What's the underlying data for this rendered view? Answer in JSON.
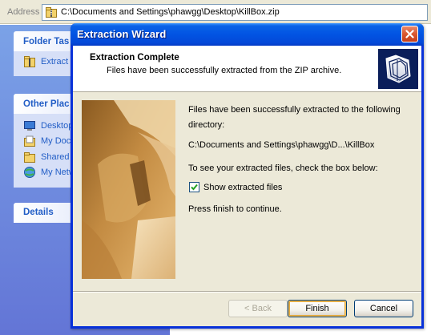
{
  "address_bar": {
    "label": "Address",
    "path": "C:\\Documents and Settings\\phawgg\\Desktop\\KillBox.zip"
  },
  "task_pane": {
    "folder_tasks": {
      "title": "Folder Tas",
      "items": [
        {
          "label": "Extract",
          "icon": "extract-zip-icon"
        }
      ]
    },
    "other_places": {
      "title": "Other Plac",
      "items": [
        {
          "label": "Desktop",
          "icon": "desktop-icon"
        },
        {
          "label": "My Doc",
          "icon": "my-documents-icon"
        },
        {
          "label": "Shared",
          "icon": "shared-folder-icon"
        },
        {
          "label": "My Netw",
          "icon": "my-network-icon"
        }
      ]
    },
    "details": {
      "title": "Details"
    }
  },
  "wizard": {
    "title": "Extraction Wizard",
    "header_title": "Extraction Complete",
    "header_subtitle": "Files have been successfully extracted from the ZIP archive.",
    "message_line1": "Files have been successfully extracted to the following",
    "message_line2": "directory:",
    "directory": "C:\\Documents and Settings\\phawgg\\D...\\KillBox",
    "checkbox_prompt": "To see your extracted files, check the box below:",
    "checkbox_label": "Show extracted files",
    "checkbox_checked": true,
    "finish_prompt": "Press finish to continue.",
    "buttons": {
      "back": "< Back",
      "finish": "Finish",
      "cancel": "Cancel"
    }
  },
  "colors": {
    "titlebar": "#0254e3",
    "task_pane_bg": "#6375d6",
    "task_link": "#215dc6",
    "dialog_face": "#ece9d8"
  }
}
